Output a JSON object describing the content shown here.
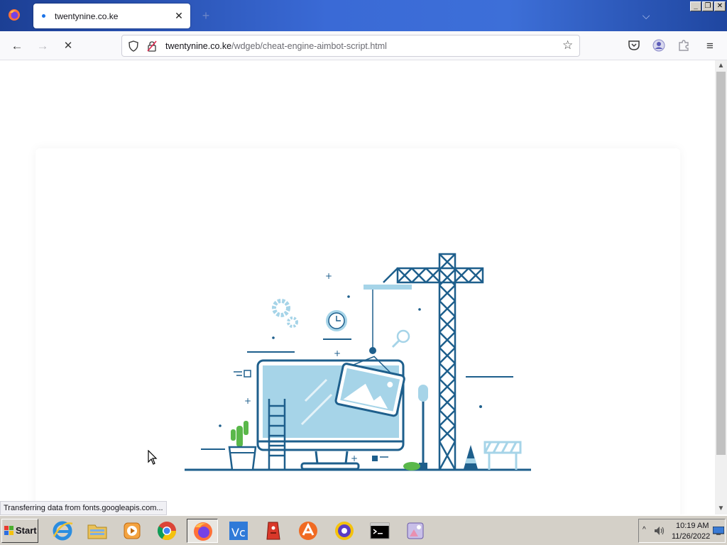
{
  "window": {
    "tab_title": "twentynine.co.ke",
    "close_tab_symbol": "✕",
    "new_tab_symbol": "+",
    "list_tabs_symbol": "⌵",
    "minimize_symbol": "_",
    "restore_symbol": "❐",
    "close_symbol": "✕"
  },
  "navbar": {
    "back_symbol": "←",
    "forward_symbol": "→",
    "stop_symbol": "✕",
    "url_host": "twentynine.co.ke",
    "url_path": "/wdgeb/cheat-engine-aimbot-script.html",
    "bookmark_symbol": "☆",
    "menu_symbol": "≡",
    "icons": [
      "shield-icon",
      "insecure-lock-icon",
      "pocket-icon",
      "account-icon",
      "extensions-icon"
    ]
  },
  "content": {
    "status_text": "Transferring data from fonts.googleapis.com...",
    "illustration": "under-construction-illustration",
    "scroll_up_symbol": "▲",
    "scroll_down_symbol": "▼"
  },
  "taskbar": {
    "start_label": "Start",
    "apps": [
      "internet-explorer",
      "file-explorer",
      "media-player",
      "chrome",
      "firefox",
      "vscode",
      "red-app",
      "avast",
      "avast-secureline",
      "command-prompt",
      "image-viewer"
    ],
    "tray_arrow": "^",
    "clock_time": "10:19 AM",
    "clock_date": "11/26/2022"
  },
  "colors": {
    "titlebar": "#3a6ad6",
    "illustration_dark": "#1e5f8c",
    "illustration_light": "#a6d4e8",
    "cactus": "#5ab84a"
  }
}
